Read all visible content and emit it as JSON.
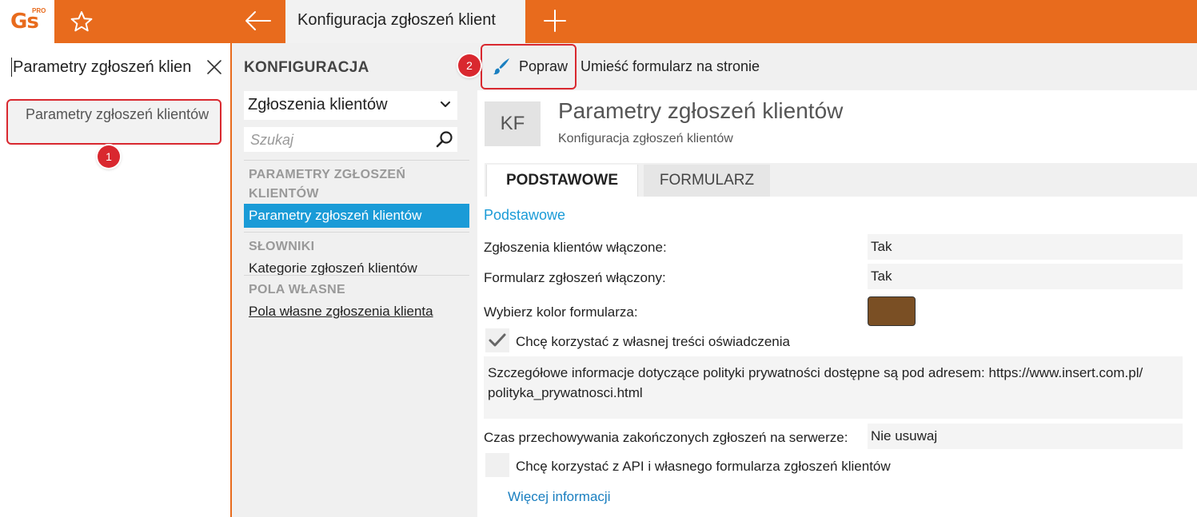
{
  "app": {
    "logo_text": "Gs",
    "logo_badge": "PRO",
    "tab_title": "Konfiguracja zgłoszeń klient"
  },
  "search": {
    "value": "Parametry zgłoszeń klien",
    "results": [
      {
        "label": "Parametry zgłoszeń klientów"
      }
    ]
  },
  "annotations": {
    "step1": "1",
    "step2": "2"
  },
  "config_nav": {
    "heading": "KONFIGURACJA",
    "module_select": "Zgłoszenia klientów",
    "search_placeholder": "Szukaj",
    "groups": [
      {
        "title": "PARAMETRY ZGŁOSZEŃ KLIENTÓW",
        "items": [
          {
            "label": "Parametry zgłoszeń klientów",
            "active": true
          }
        ]
      },
      {
        "title": "SŁOWNIKI",
        "items": [
          {
            "label": "Kategorie zgłoszeń klientów",
            "active": false
          }
        ]
      },
      {
        "title": "POLA WŁASNE",
        "items": [
          {
            "label": "Pola własne zgłoszenia klienta",
            "active": false
          }
        ]
      }
    ]
  },
  "toolbar": {
    "edit_label": "Popraw",
    "place_form_label": "Umieść formularz na stronie"
  },
  "header": {
    "initials": "KF",
    "title": "Parametry zgłoszeń klientów",
    "subtitle": "Konfiguracja zgłoszeń klientów"
  },
  "tabs": [
    {
      "label": "PODSTAWOWE",
      "active": true
    },
    {
      "label": "FORMULARZ",
      "active": false
    }
  ],
  "form": {
    "section_title": "Podstawowe",
    "enabled_label": "Zgłoszenia klientów włączone:",
    "enabled_value": "Tak",
    "form_enabled_label": "Formularz zgłoszeń włączony:",
    "form_enabled_value": "Tak",
    "color_label": "Wybierz kolor formularza:",
    "color_value": "#7a4f24",
    "own_statement_label": "Chcę korzystać z własnej treści oświadczenia",
    "own_statement_checked": true,
    "statement_text": "Szczegółowe informacje dotyczące polityki prywatności dostępne są pod adresem: https://www.insert.com.pl/ polityka_prywatnosci.html",
    "retention_label": "Czas przechowywania zakończonych zgłoszeń na serwerze:",
    "retention_value": "Nie usuwaj",
    "api_label": "Chcę korzystać z API i własnego formularza zgłoszeń klientów",
    "api_checked": false,
    "more_info_link": "Więcej informacji"
  },
  "colors": {
    "accent_orange": "#e86b1d",
    "selection_blue": "#1a9bd7",
    "annotation_red": "#d9282f"
  }
}
